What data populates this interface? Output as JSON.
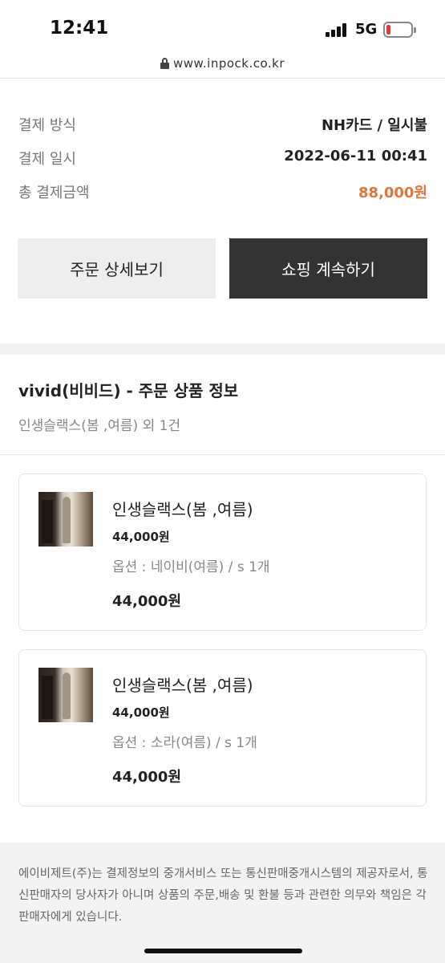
{
  "status_bar": {
    "time": "12:41",
    "network": "5G",
    "battery_color": "#e23b3b"
  },
  "browser": {
    "url": "www.inpock.co.kr"
  },
  "payment": {
    "rows": [
      {
        "label": "결제 방식",
        "value": "NH카드 / 일시불"
      },
      {
        "label": "결제 일시",
        "value": "2022-06-11 00:41"
      },
      {
        "label": "총 결제금액",
        "value": "88,000원"
      }
    ],
    "accent_color": "#e0743d"
  },
  "actions": {
    "detail_label": "주문 상세보기",
    "continue_label": "쇼핑 계속하기"
  },
  "order": {
    "title": "vivid(비비드) - 주문 상품 정보",
    "subtitle": "인생슬랙스(봄 ,여름) 외 1건",
    "items": [
      {
        "name": "인생슬랙스(봄 ,여름)",
        "price": "44,000원",
        "option": "옵션 : 네이비(여름) / s 1개",
        "total": "44,000원"
      },
      {
        "name": "인생슬랙스(봄 ,여름)",
        "price": "44,000원",
        "option": "옵션 : 소라(여름) / s 1개",
        "total": "44,000원"
      }
    ]
  },
  "footer": {
    "notice": "에이비제트(주)는 결제정보의 중개서비스 또는 통신판매중개시스템의 제공자로서, 통신판매자의 당사자가 아니며 상품의 주문,배송 및 환불 등과 관련한 의무와 책임은 각 판매자에게 있습니다."
  }
}
